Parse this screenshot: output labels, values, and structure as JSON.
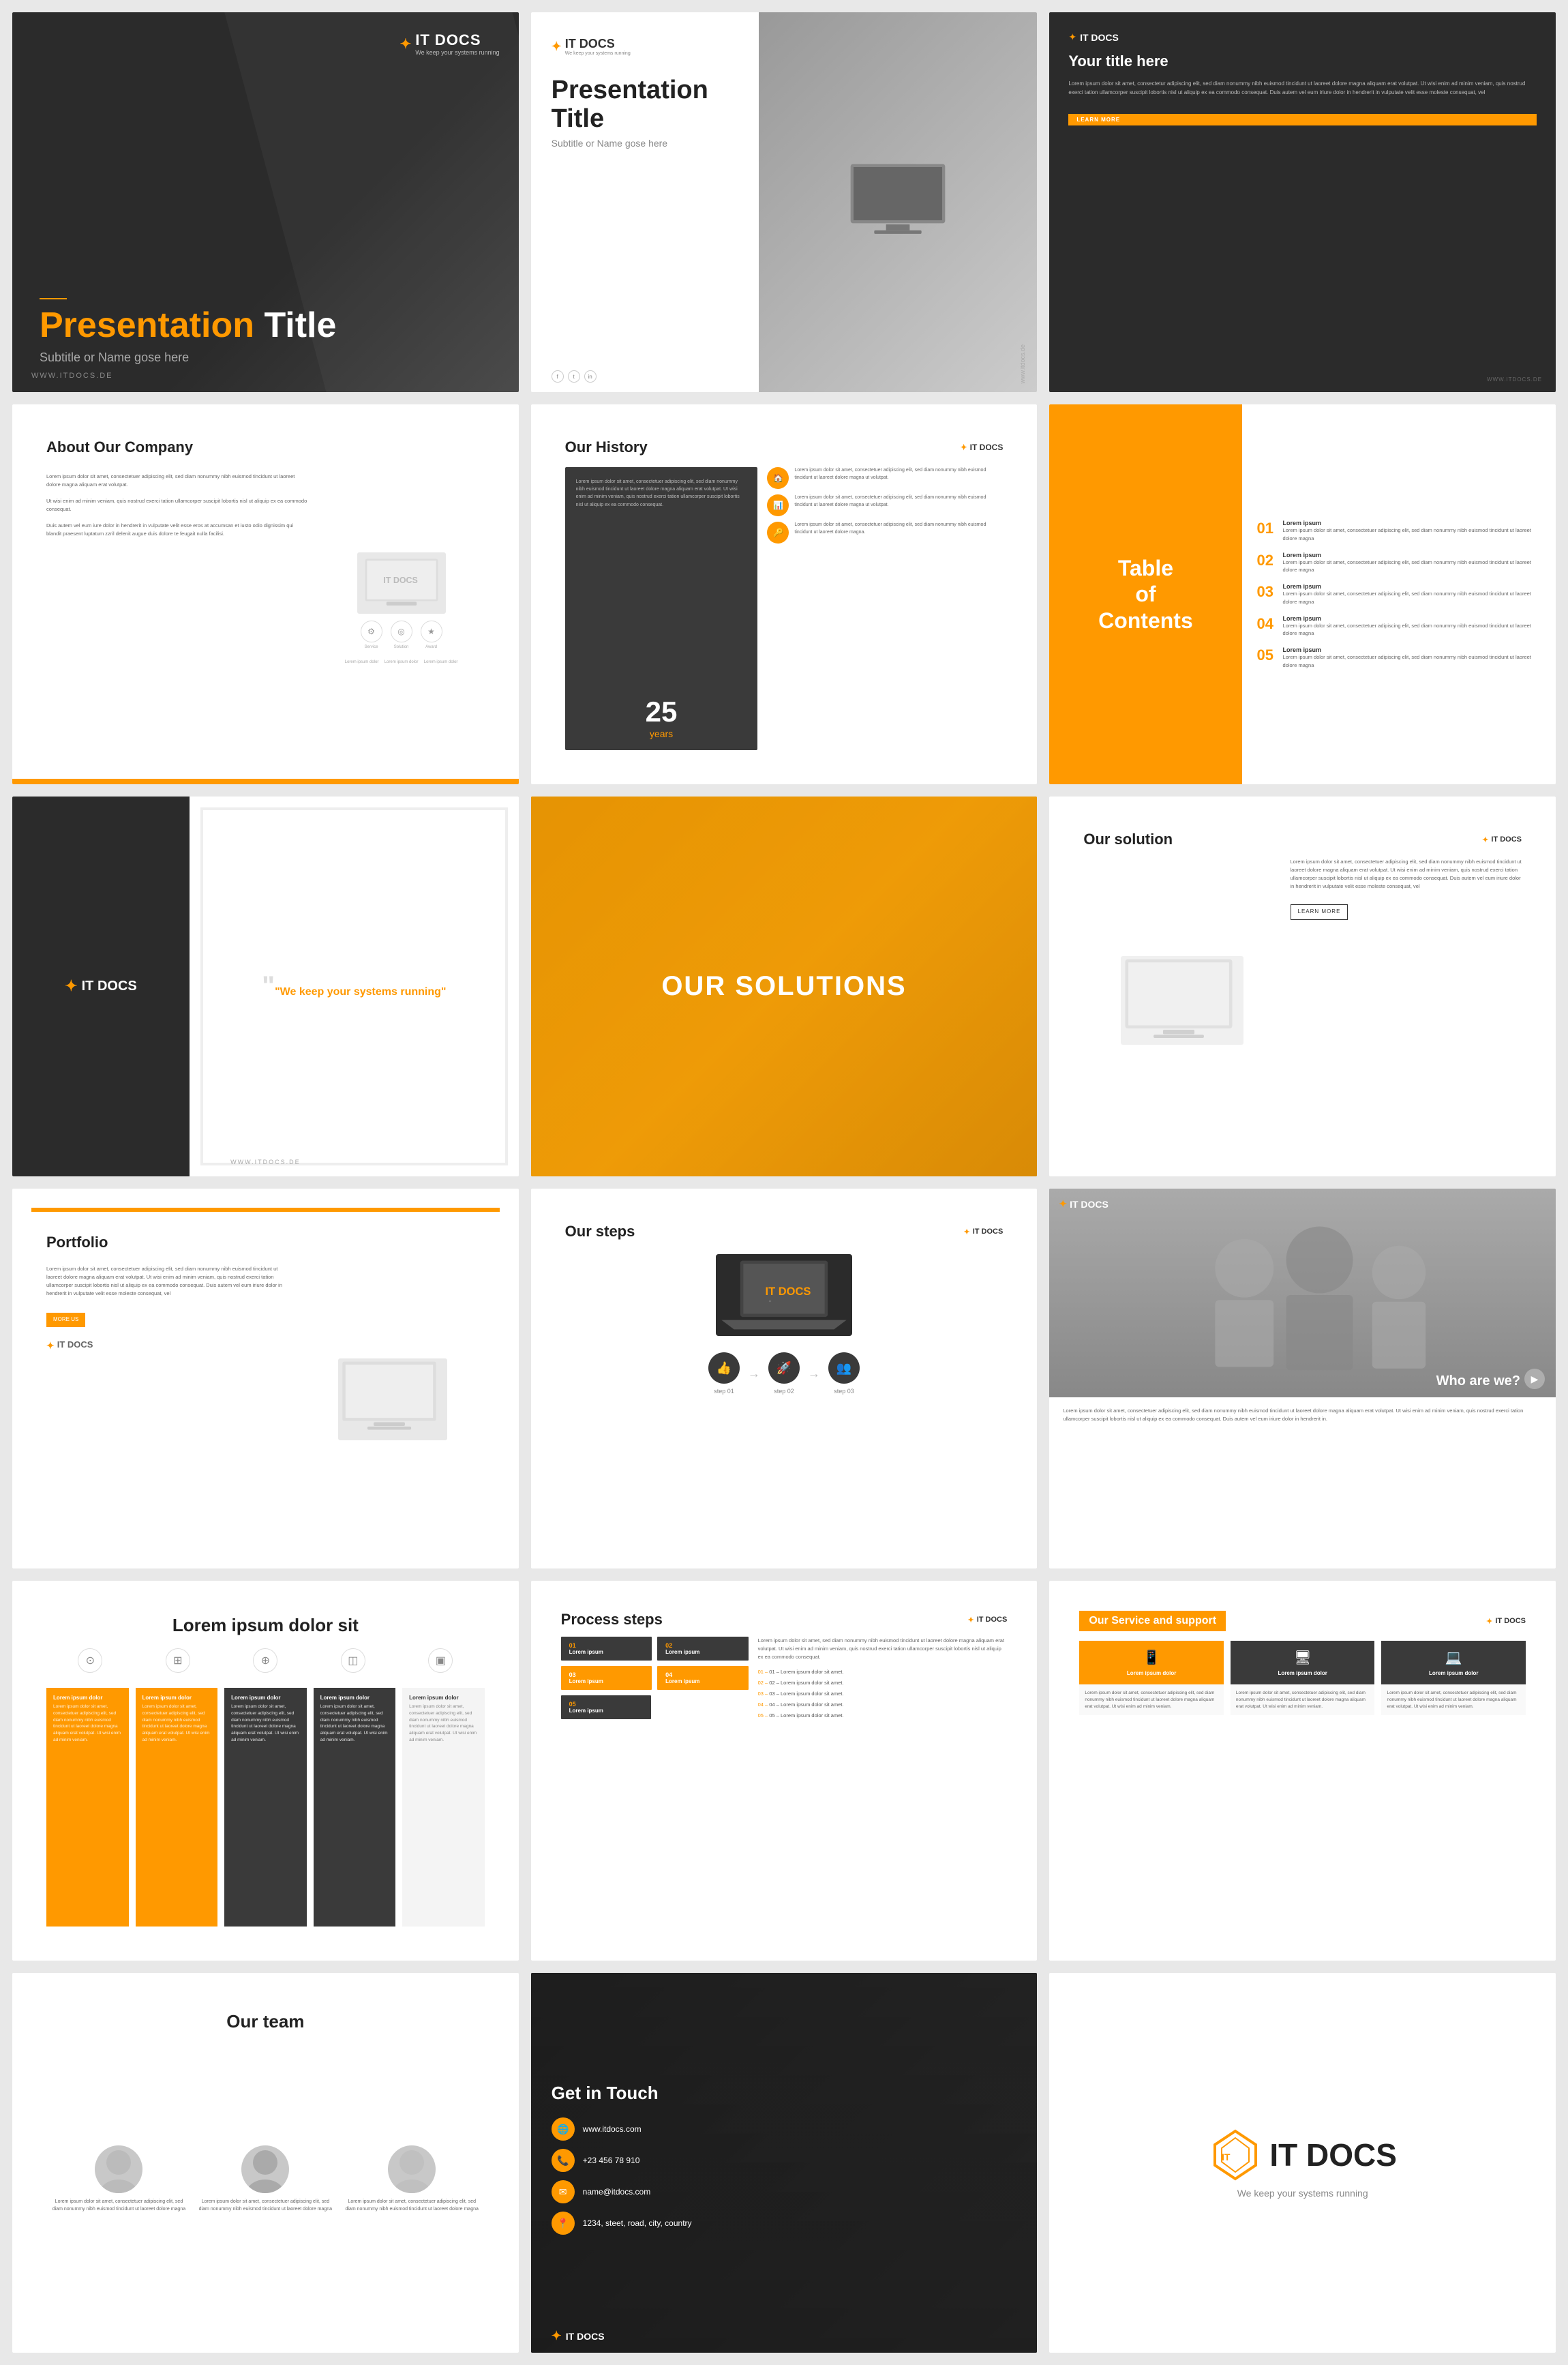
{
  "brand": {
    "name": "IT DOCS",
    "icon": "✦",
    "tagline": "We keep your systems running",
    "website": "WWW.ITDOCS.DE"
  },
  "slide1": {
    "title_bold": "Presentation",
    "title_rest": " Title",
    "subtitle": "Subtitle or Name gose here",
    "website": "WWW.ITDOCS.DE"
  },
  "slide2": {
    "title": "Presentation Title",
    "subtitle": "Subtitle or Name gose here",
    "website": "www.itdocs.de"
  },
  "slide3": {
    "heading": "Your title here",
    "body": "Lorem ipsum dolor sit amet, consectetur adipiscing elit, sed diam nonummy nibh euismod tincidunt ut laoreet dolore magna aliquam erat volutpat. Ut wisi enim ad minim veniam, quis nostrud exerci tation ullamcorper suscipit lobortis nisl ut aliquip ex ea commodo consequat. Duis autem vel eum iriure dolor in hendrerit in vulputate velit esse moleste consequat, vel",
    "btn": "LEARN MORE",
    "website": "WWW.ITDOCS.DE"
  },
  "slide4": {
    "heading": "About Our Company",
    "text1": "Lorem ipsum dolor sit amet, consectetuer adipiscing elit, sed diam nonummy nibh euismod tincidunt ut laoreet dolore magna aliquam erat volutpat.",
    "text2": "Ut wisi enim ad minim veniam, quis nostrud exerci tation ullamcorper suscipit lobortis nisl ut aliquip ex ea commodo consequat.",
    "text3": "Duis autem vel eum iure dolor in hendrerit in vulputate velit esse eros at accumsan et iusto odio dignissim qui blandit praesent luptatum zzril delenit augue duis dolore te feugait nulla facilisi.",
    "icons": [
      "⚙",
      "🎯",
      "🏆"
    ]
  },
  "slide5": {
    "heading": "Our History",
    "left_text": "Lorem ipsum dolor sit amet, consectetuer adipiscing elit, sed diam nonummy nibh euismod tincidunt ut laoreet dolore magna aliquam erat volutpat. Ut wisi enim ad minim veniam, quis nostrud exerci tation ullamcorper suscipit lobortis nisl ut aliquip ex ea commodo consequat.",
    "years": "25",
    "years_label": "years",
    "items": [
      {
        "icon": "🏠",
        "text": "Lorem ipsum dolor sit amet, consectetuer adipiscing elit, sed diam nonummy nibh euismod tincidunt ut laoreet dolore magna ut volutpat."
      },
      {
        "icon": "📊",
        "text": "Lorem ipsum dolor sit amet, consectetuer adipiscing elit, sed diam nonummy nibh euismod tincidunt ut laoreet dolore magna ut volutpat."
      },
      {
        "icon": "🔑",
        "text": "Lorem ipsum dolor sit amet, consectetuer adipiscing elit, sed diam nonummy nibh euismod tincidunt ut laoreet dolore magna."
      }
    ]
  },
  "slide6": {
    "heading": "Table of Contents",
    "heading_lines": [
      "Table",
      "of",
      "Contents"
    ],
    "items": [
      {
        "num": "01",
        "title": "Lorem ipsum",
        "text": "Lorem ipsum dolor sit amet, consectetuer adipiscing elit, sed diam nonummy nibh euismod tincidunt ut laoreet dolore magna"
      },
      {
        "num": "02",
        "title": "Lorem ipsum",
        "text": "Lorem ipsum dolor sit amet, consectetuer adipiscing elit, sed diam nonummy nibh euismod tincidunt ut laoreet dolore magna"
      },
      {
        "num": "03",
        "title": "Lorem ipsum",
        "text": "Lorem ipsum dolor sit amet, consectetuer adipiscing elit, sed diam nonummy nibh euismod tincidunt ut laoreet dolore magna"
      },
      {
        "num": "04",
        "title": "Lorem ipsum",
        "text": "Lorem ipsum dolor sit amet, consectetuer adipiscing elit, sed diam nonummy nibh euismod tincidunt ut laoreet dolore magna"
      },
      {
        "num": "05",
        "title": "Lorem ipsum",
        "text": "Lorem ipsum dolor sit amet, consectetuer adipiscing elit, sed diam nonummy nibh euismod tincidunt ut laoreet dolore magna"
      }
    ]
  },
  "slide7": {
    "quote": "\"We keep your systems running\"",
    "website": "WWW.ITDOCS.DE"
  },
  "slide8": {
    "heading": "OUR SOLUTIONS"
  },
  "slide9": {
    "heading": "Our solution",
    "text": "Lorem ipsum dolor sit amet, consectetuer adipiscing elit, sed diam nonummy nibh euismod tincidunt ut laoreet dolore magna aliquam erat volutpat. Ut wisi enim ad minim veniam, quis nostrud exerci tation ullamcorper suscipit lobortis nisl ut aliquip ex ea commodo consequat. Duis autem vel eum iriure dolor in hendrerit in vulputate velit esse moleste consequat, vel",
    "btn": "LEARN MORE"
  },
  "slide10": {
    "heading": "Portfolio",
    "text": "Lorem ipsum dolor sit amet, consectetuer adipiscing elit, sed diam nonummy nibh euismod tincidunt ut laoreet dolore magna aliquam erat volutpat. Ut wisi enim ad minim veniam, quis nostrud exerci tation ullamcorper suscipit lobortis nisl ut aliquip ex ea commodo consequat. Duis autem vel eum iriure dolor in hendrerit in vulputate velit esse moleste consequat, vel",
    "btn": "MORE US"
  },
  "slide11": {
    "heading": "Our steps",
    "steps": [
      {
        "icon": "👍",
        "label": "step 01"
      },
      {
        "icon": "🚀",
        "label": "step 02"
      },
      {
        "icon": "👥",
        "label": "step 03"
      }
    ]
  },
  "slide12": {
    "heading": "Who are we?",
    "text": "Lorem ipsum dolor sit amet, consectetuer adipiscing elit, sed diam nonummy nibh euismod tincidunt ut laoreet dolore magna aliquam erat volutpat. Ut wisi enim ad minim veniam, quis nostrud exerci tation ullamcorper suscipit lobortis nisl ut aliquip ex ea commodo consequat. Duis autem vel eum iriure dolor in hendrerit in."
  },
  "slide13": {
    "heading": "Lorem ipsum dolor sit",
    "icons": [
      "⊙",
      "⊞",
      "⊕",
      "◫",
      "▣"
    ],
    "cards": [
      {
        "title": "Lorem ipsum dolor",
        "text": "Lorem ipsum dolor sit amet, consectetuer adipiscing elit, sed diam nonummy nibh euismod tincidunt ut laoreet dolore magna aliquam erat volutpat. Ut wisi enim ad minim veniam.",
        "type": "orange"
      },
      {
        "title": "Lorem ipsum dolor",
        "text": "Lorem ipsum dolor sit amet, consectetuer adipiscing elit, sed diam nonummy nibh euismod tincidunt ut laoreet dolore magna aliquam erat volutpat. Ut wisi enim ad minim veniam.",
        "type": "orange"
      },
      {
        "title": "Lorem ipsum dolor",
        "text": "Lorem ipsum dolor sit amet, consectetuer adipiscing elit, sed diam nonummy nibh euismod tincidunt ut laoreet dolore magna aliquam erat volutpat. Ut wisi enim ad minim veniam.",
        "type": "dark"
      },
      {
        "title": "Lorem ipsum dolor",
        "text": "Lorem ipsum dolor sit amet, consectetuer adipiscing elit, sed diam nonummy nibh euismod tincidunt ut laoreet dolore magna aliquam erat volutpat. Ut wisi enim ad minim veniam.",
        "type": "dark"
      },
      {
        "title": "Lorem ipsum dolor",
        "text": "Lorem ipsum dolor sit amet, consectetuer adipiscing elit, sed diam nonummy nibh euismod tincidunt ut laoreet dolore magna aliquam erat volutpat. Ut wisi enim ad minim veniam.",
        "type": "light"
      }
    ]
  },
  "slide14": {
    "heading": "Process steps",
    "text": "Lorem ipsum dolor sit amet, sed diam nonummy nibh euismod tincidunt ut laoreet dolore magna aliquam erat volutpat. Ut wisi enim ad minim veniam, quis nostrud exerci tation ullamcorper suscipit lobortis nisl ut aliquip ex ea commodo consequat.",
    "steps": [
      {
        "num": "01",
        "label": "Lorem ipsum",
        "type": "dark"
      },
      {
        "num": "02",
        "label": "Lorem ipsum",
        "type": "dark"
      },
      {
        "num": "03",
        "label": "Lorem ipsum",
        "type": "orange"
      },
      {
        "num": "04",
        "label": "Lorem ipsum",
        "type": "orange"
      },
      {
        "num": "05",
        "label": "Lorem ipsum",
        "type": "dark"
      }
    ],
    "list": [
      "Lorem ipsum dolor sit amet.",
      "Lorem ipsum dolor sit amet.",
      "Lorem ipsum dolor sit amet.",
      "Lorem ipsum dolor sit amet.",
      "Lorem ipsum dolor sit amet."
    ]
  },
  "slide15": {
    "heading": "Our Service and support",
    "cards": [
      {
        "icon": "📱",
        "title": "Lorem ipsum dolor",
        "text": "Lorem ipsum dolor sit amet, consectetuer adipiscing elit, sed diam nonummy nibh euismod tincidunt ut laoreet dolore magna aliquam erat volutpat. Ut wisi enim ad minim veniam.",
        "type": "orange"
      },
      {
        "icon": "🖥",
        "title": "Lorem ipsum dolor",
        "text": "Lorem ipsum dolor sit amet, consectetuer adipiscing elit, sed diam nonummy nibh euismod tincidunt ut laoreet dolore magna aliquam erat volutpat. Ut wisi enim ad minim veniam.",
        "type": "dark"
      },
      {
        "icon": "💻",
        "title": "Lorem ipsum dolor",
        "text": "Lorem ipsum dolor sit amet, consectetuer adipiscing elit, sed diam nonummy nibh euismod tincidunt ut laoreet dolore magna aliquam erat volutpat. Ut wisi enim ad minim veniam.",
        "type": "dark"
      }
    ]
  },
  "slide16": {
    "heading": "Our team",
    "members": [
      {
        "text": "Lorem ipsum dolor sit amet, consectetuer adipiscing elit, sed diam nonummy nibh euismod tincidunt ut laoreet dolore magna"
      },
      {
        "text": "Lorem ipsum dolor sit amet, consectetuer adipiscing elit, sed diam nonummy nibh euismod tincidunt ut laoreet dolore magna"
      },
      {
        "text": "Lorem ipsum dolor sit amet, consectetuer adipiscing elit, sed diam nonummy nibh euismod tincidunt ut laoreet dolore magna"
      }
    ]
  },
  "slide17": {
    "heading": "Get in Touch",
    "contacts": [
      {
        "icon": "🌐",
        "text": "www.itdocs.com"
      },
      {
        "icon": "📞",
        "text": "+23 456 78 910"
      },
      {
        "icon": "✉",
        "text": "name@itdocs.com"
      },
      {
        "icon": "📍",
        "text": "1234, steet, road, city, country"
      }
    ]
  },
  "slide18": {
    "tagline": "We keep your systems running"
  }
}
